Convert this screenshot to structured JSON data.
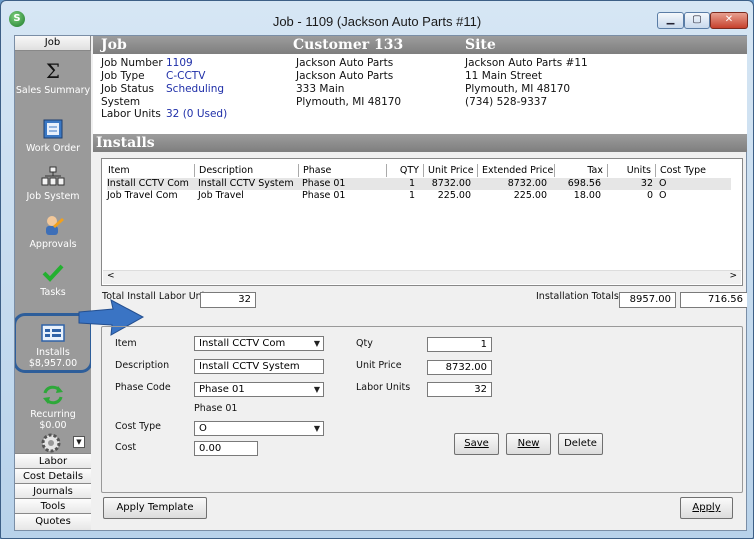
{
  "window": {
    "title": "Job - 1109 (Jackson Auto Parts #11)",
    "app_icon_letter": "S"
  },
  "sidebar": {
    "header": "Job",
    "items": [
      {
        "label": "Sales Summary",
        "icon": "sigma-icon"
      },
      {
        "label": "Work Order",
        "icon": "work-order-icon"
      },
      {
        "label": "Job System",
        "icon": "job-system-icon"
      },
      {
        "label": "Approvals",
        "icon": "approvals-icon"
      },
      {
        "label": "Tasks",
        "icon": "checkmark-icon"
      },
      {
        "label": "Installs",
        "sub": "$8,957.00",
        "icon": "installs-icon"
      },
      {
        "label": "Recurring",
        "sub": "$0.00",
        "icon": "recurring-icon"
      }
    ],
    "bottom": [
      "Labor",
      "Cost Details",
      "Journals",
      "Tools",
      "Quotes"
    ]
  },
  "job": {
    "section_title": "Job",
    "number_label": "Job Number",
    "number": "1109",
    "type_label": "Job Type",
    "type": "C-CCTV",
    "status_label": "Job Status",
    "status": "Scheduling",
    "system_label": "System",
    "labor_label": "Labor Units",
    "labor": "32 (0 Used)"
  },
  "customer": {
    "section_title": "Customer 133",
    "lines": [
      "Jackson Auto Parts",
      "Jackson Auto Parts",
      "333 Main",
      "Plymouth, MI  48170"
    ]
  },
  "site": {
    "section_title": "Site",
    "lines": [
      "Jackson Auto Parts #11",
      "11 Main Street",
      "Plymouth, MI  48170",
      "(734) 528-9337"
    ]
  },
  "installs": {
    "section_title": "Installs",
    "columns": [
      "Item",
      "Description",
      "Phase",
      "QTY",
      "Unit Price",
      "Extended Price",
      "Tax",
      "Units",
      "Cost Type"
    ],
    "rows": [
      [
        "Install CCTV Com",
        "Install CCTV System",
        "Phase 01",
        "1",
        "8732.00",
        "8732.00",
        "698.56",
        "32",
        "O"
      ],
      [
        "Job Travel Com",
        "Job Travel",
        "Phase 01",
        "1",
        "225.00",
        "225.00",
        "18.00",
        "0",
        "O"
      ]
    ],
    "total_labor_label": "Total Install Labor Units",
    "total_labor": "32",
    "totals_label": "Installation Totals",
    "total_extended": "8957.00",
    "total_tax": "716.56"
  },
  "form": {
    "item_label": "Item",
    "item": "Install CCTV Com",
    "description_label": "Description",
    "description": "Install CCTV System",
    "phase_label": "Phase Code",
    "phase": "Phase 01",
    "phase_desc": "Phase 01",
    "cost_type_label": "Cost Type",
    "cost_type": "O",
    "cost_label": "Cost",
    "cost": "0.00",
    "qty_label": "Qty",
    "qty": "1",
    "unit_price_label": "Unit Price",
    "unit_price": "8732.00",
    "labor_units_label": "Labor Units",
    "labor_units": "32",
    "save": "Save",
    "new": "New",
    "delete": "Delete"
  },
  "footer": {
    "apply_template": "Apply Template",
    "apply": "Apply"
  }
}
